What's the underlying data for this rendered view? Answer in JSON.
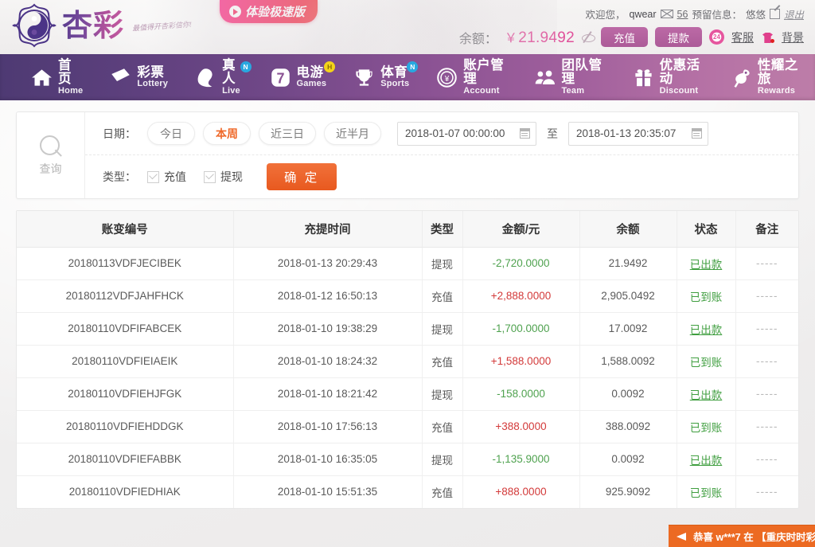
{
  "header": {
    "logo_text": "杏彩",
    "logo_slogan": "最值得开杏彩信你!",
    "promo_label": "体验极速版",
    "welcome_prefix": "欢迎您，",
    "username": "qwear",
    "mail_count": "56",
    "reserve_label": "预留信息：",
    "reserve_value": "悠悠",
    "logout": "退出",
    "balance_label": "余额：",
    "balance_currency": "￥",
    "balance_value": "21.9492",
    "deposit_label": "充值",
    "withdraw_label": "提款",
    "service_badge": "24",
    "service_label": "客服",
    "background_label": "背景"
  },
  "nav": {
    "items": [
      {
        "cn": "首页",
        "en": "Home",
        "icon": "home-icon",
        "badge": ""
      },
      {
        "cn": "彩票",
        "en": "Lottery",
        "icon": "ticket-icon",
        "badge": ""
      },
      {
        "cn": "真人",
        "en": "Live",
        "icon": "live-icon",
        "badge": "N"
      },
      {
        "cn": "电游",
        "en": "Games",
        "icon": "seven-icon",
        "badge": "H"
      },
      {
        "cn": "体育",
        "en": "Sports",
        "icon": "trophy-icon",
        "badge": "N"
      },
      {
        "cn": "账户管理",
        "en": "Account",
        "icon": "coin-icon",
        "badge": ""
      },
      {
        "cn": "团队管理",
        "en": "Team",
        "icon": "users-icon",
        "badge": ""
      },
      {
        "cn": "优惠活动",
        "en": "Discount",
        "icon": "gift-icon",
        "badge": ""
      },
      {
        "cn": "性耀之旅",
        "en": "Rewards",
        "icon": "rewards-icon",
        "badge": ""
      }
    ]
  },
  "filter": {
    "search_label": "查询",
    "date_label": "日期：",
    "quick_ranges": [
      {
        "label": "今日",
        "active": false
      },
      {
        "label": "本周",
        "active": true
      },
      {
        "label": "近三日",
        "active": false
      },
      {
        "label": "近半月",
        "active": false
      }
    ],
    "date_from": "2018-01-07 00:00:00",
    "date_to": "2018-01-13 20:35:07",
    "to_word": "至",
    "type_label": "类型：",
    "checkboxes": [
      {
        "label": "充值",
        "checked": true
      },
      {
        "label": "提现",
        "checked": true
      }
    ],
    "confirm_label": "确 定"
  },
  "table": {
    "columns": [
      "账变编号",
      "充提时间",
      "类型",
      "金额/元",
      "余额",
      "状态",
      "备注"
    ],
    "rows": [
      {
        "id": "20180113VDFJECIBEK",
        "time": "2018-01-13 20:29:43",
        "type": "提现",
        "amount": "-2,720.0000",
        "sign": "neg",
        "balance": "21.9492",
        "status": "已出款",
        "status_kind": "out",
        "remark": "-----"
      },
      {
        "id": "20180112VDFJAHFHCK",
        "time": "2018-01-12 16:50:13",
        "type": "充值",
        "amount": "+2,888.0000",
        "sign": "pos",
        "balance": "2,905.0492",
        "status": "已到账",
        "status_kind": "in",
        "remark": "-----"
      },
      {
        "id": "20180110VDFIFABCEK",
        "time": "2018-01-10 19:38:29",
        "type": "提现",
        "amount": "-1,700.0000",
        "sign": "neg",
        "balance": "17.0092",
        "status": "已出款",
        "status_kind": "out",
        "remark": "-----"
      },
      {
        "id": "20180110VDFIEIAEIK",
        "time": "2018-01-10 18:24:32",
        "type": "充值",
        "amount": "+1,588.0000",
        "sign": "pos",
        "balance": "1,588.0092",
        "status": "已到账",
        "status_kind": "in",
        "remark": "-----"
      },
      {
        "id": "20180110VDFIEHJFGK",
        "time": "2018-01-10 18:21:42",
        "type": "提现",
        "amount": "-158.0000",
        "sign": "neg",
        "balance": "0.0092",
        "status": "已出款",
        "status_kind": "out",
        "remark": "-----"
      },
      {
        "id": "20180110VDFIEHDDGK",
        "time": "2018-01-10 17:56:13",
        "type": "充值",
        "amount": "+388.0000",
        "sign": "pos",
        "balance": "388.0092",
        "status": "已到账",
        "status_kind": "in",
        "remark": "-----"
      },
      {
        "id": "20180110VDFIEFABBK",
        "time": "2018-01-10 16:35:05",
        "type": "提现",
        "amount": "-1,135.9000",
        "sign": "neg",
        "balance": "0.0092",
        "status": "已出款",
        "status_kind": "out",
        "remark": "-----"
      },
      {
        "id": "20180110VDFIEDHIAK",
        "time": "2018-01-10 15:51:35",
        "type": "充值",
        "amount": "+888.0000",
        "sign": "pos",
        "balance": "925.9092",
        "status": "已到账",
        "status_kind": "in",
        "remark": "-----"
      }
    ]
  },
  "marquee": {
    "text": "恭喜 w***7 在 【重庆时时彩"
  },
  "colors": {
    "accent_orange": "#e8591f",
    "brand_pink": "#e0509a",
    "nav_left": "#4e3a73",
    "nav_right": "#bd7da8",
    "positive": "#d33a3a",
    "negative": "#4fa24f",
    "status_green": "#3f9e3f"
  }
}
